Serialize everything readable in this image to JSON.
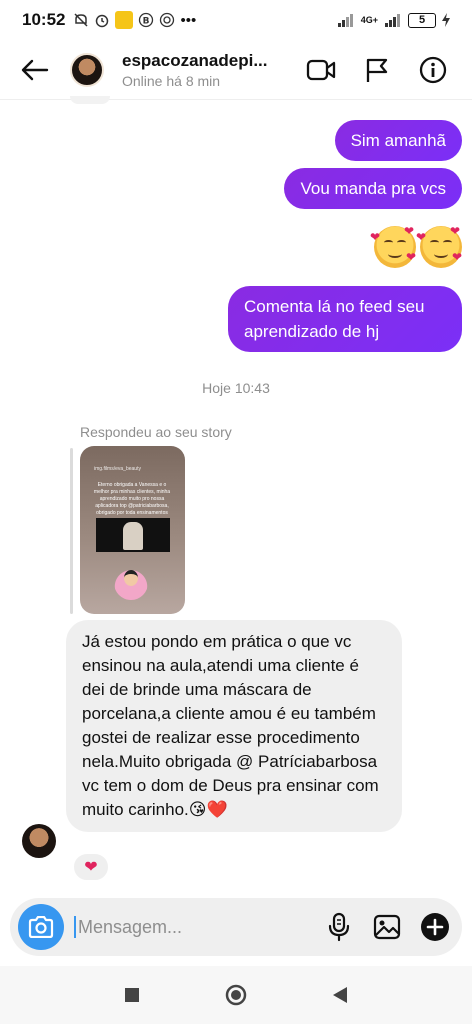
{
  "status_bar": {
    "time": "10:52",
    "left_icons": [
      "mute-icon",
      "alarm-icon",
      "app-notification-icon",
      "b-icon",
      "wallet-icon"
    ],
    "more": "•••",
    "network": "4G+",
    "battery": "5"
  },
  "header": {
    "name": "espacozanadepi...",
    "status": "Online há 8 min",
    "actions": [
      "video-call-icon",
      "flag-icon",
      "info-icon"
    ]
  },
  "messages": {
    "sent": [
      "Sim amanhã",
      "Vou manda pra vcs",
      "Comenta lá no feed seu aprendizado de hj"
    ],
    "emojis": [
      "smiling-face-with-hearts",
      "smiling-face-with-hearts"
    ],
    "timestamp": "Hoje 10:43",
    "story_reply_label": "Respondeu ao seu story",
    "story_preview": {
      "user": "img.films/eva_beauty",
      "text": "Eterno obrigada a Vanessa e o melhor pra minhas clientes, minha aprendizado muito pro nossa aplicadora top @patriciabarbosa, obrigado por toda ensinamentos"
    },
    "received": "Já estou pondo em prática o que vc ensinou na aula,atendi uma cliente é dei de brinde uma máscara de porcelana,a cliente amou  é eu também gostei de realizar esse procedimento  nela.Muito obrigada @ Patríciabarbosa vc tem o dom de Deus pra ensinar com muito carinho.😘❤️",
    "reaction": "❤"
  },
  "composer": {
    "placeholder": "Mensagem...",
    "value": ""
  },
  "colors": {
    "sent_bubble": "#8a2be2",
    "received_bubble": "#efefef",
    "camera_button": "#3797f0",
    "heart": "#e0245e"
  }
}
